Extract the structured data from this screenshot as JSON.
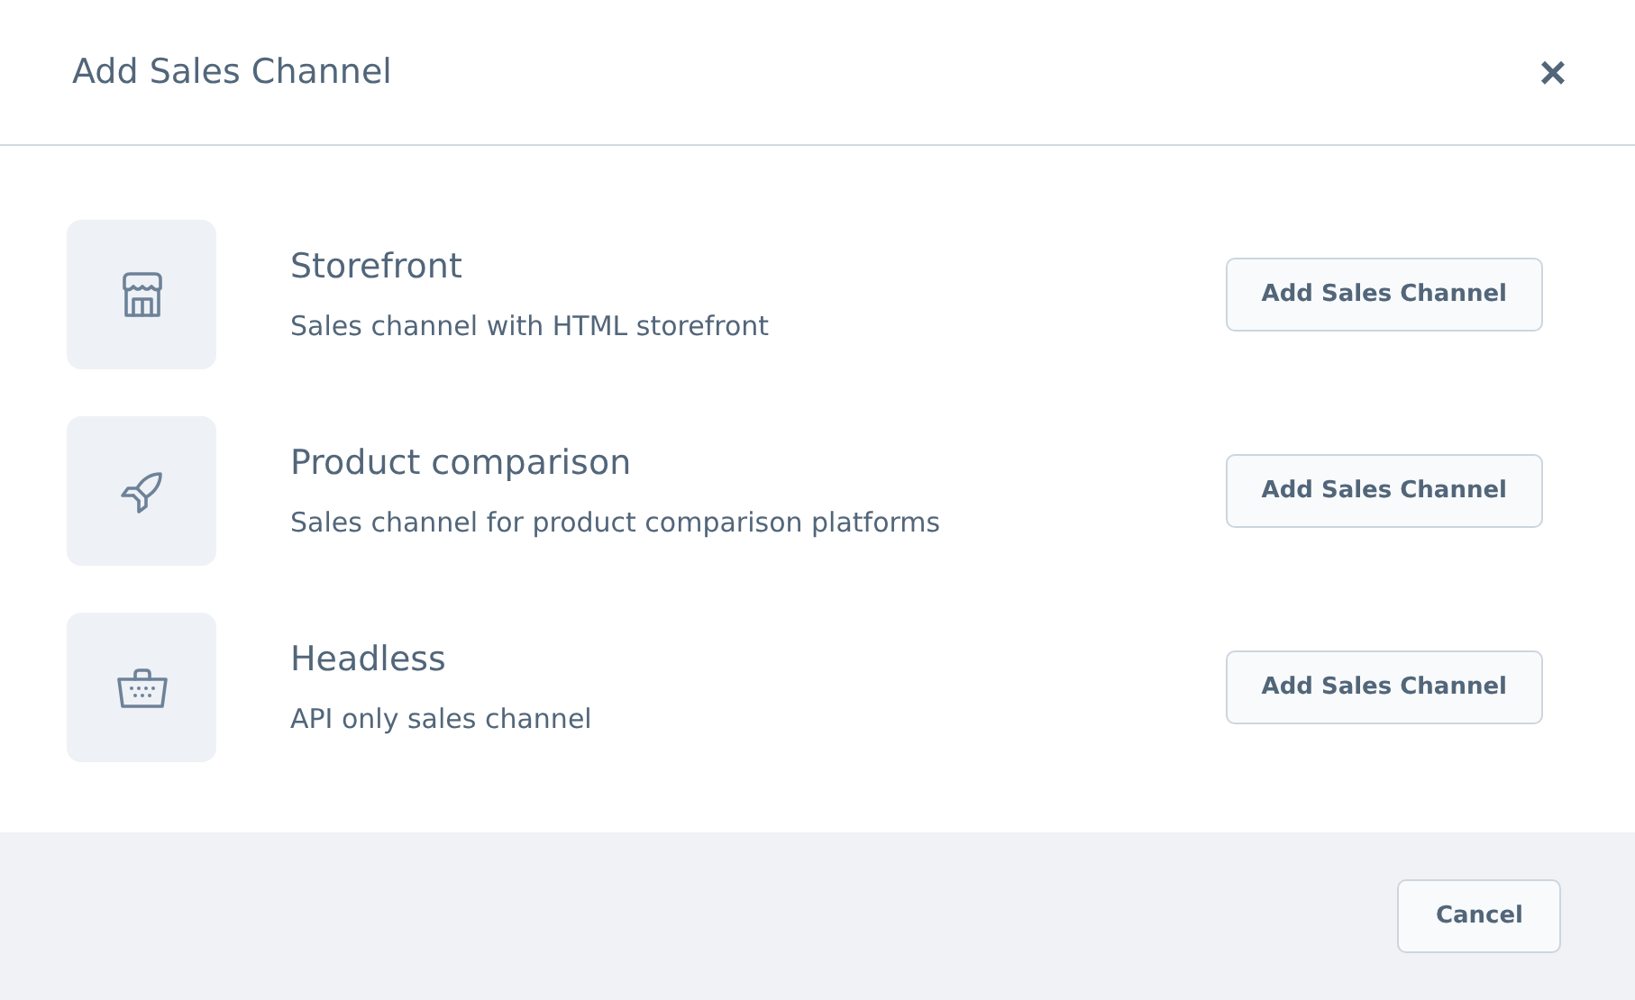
{
  "dialog": {
    "title": "Add Sales Channel",
    "close": "×"
  },
  "channels": [
    {
      "kind": "store",
      "name": "Storefront",
      "description": "Sales channel with HTML storefront",
      "button": "Add Sales Channel"
    },
    {
      "kind": "rocket",
      "name": "Product comparison",
      "description": "Sales channel for product comparison platforms",
      "button": "Add Sales Channel"
    },
    {
      "kind": "basket",
      "name": "Headless",
      "description": "API only sales channel",
      "button": "Add Sales Channel"
    }
  ],
  "footer": {
    "cancel": "Cancel"
  }
}
